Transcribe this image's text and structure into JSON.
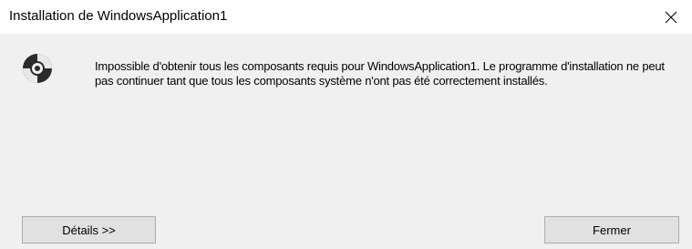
{
  "window": {
    "title": "Installation de WindowsApplication1"
  },
  "message": {
    "text": "Impossible d'obtenir tous les composants requis pour WindowsApplication1. Le programme d'installation ne peut pas continuer tant que tous les composants système n'ont pas été correctement installés."
  },
  "buttons": {
    "details_label": "Détails >>",
    "close_label": "Fermer"
  },
  "icons": {
    "title_close": "close-icon",
    "main": "disc-icon"
  },
  "colors": {
    "title_bg": "#ffffff",
    "body_bg": "#f0f0f0",
    "button_bg": "#e1e1e1",
    "button_border": "#adadad"
  }
}
